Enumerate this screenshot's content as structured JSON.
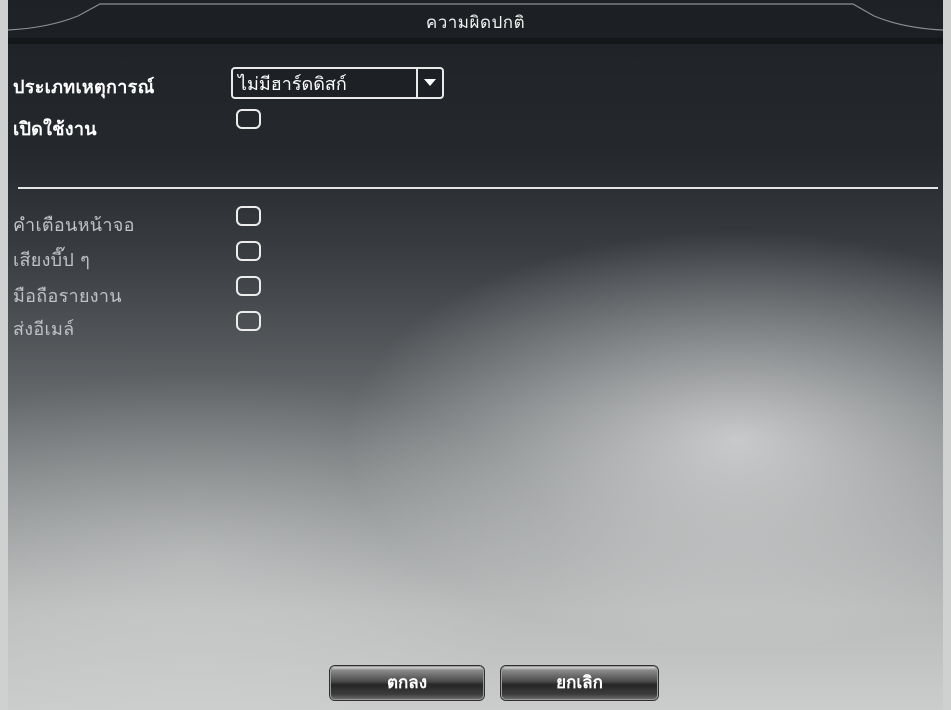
{
  "window": {
    "title": "ความผิดปกติ"
  },
  "settings": {
    "event_type_label": "ประเภทเหตุการณ์",
    "event_type_value": "ไม่มีฮาร์ดดิสก์",
    "enable_label": "เปิดใช้งาน"
  },
  "actions": {
    "screen_alert_label": "คำเตือนหน้าจอ",
    "beep_label": "เสียงบี๊ป ๆ",
    "mobile_report_label": "มือถือรายงาน",
    "send_email_label": "ส่งอีเมล์"
  },
  "buttons": {
    "ok_label": "ตกลง",
    "cancel_label": "ยกเลิก"
  },
  "icons": {
    "dropdown": "chevron-down-icon"
  },
  "colors": {
    "panel_dark": "#1e2125",
    "text": "#ffffff",
    "dim_text": "#bfc3c6"
  }
}
